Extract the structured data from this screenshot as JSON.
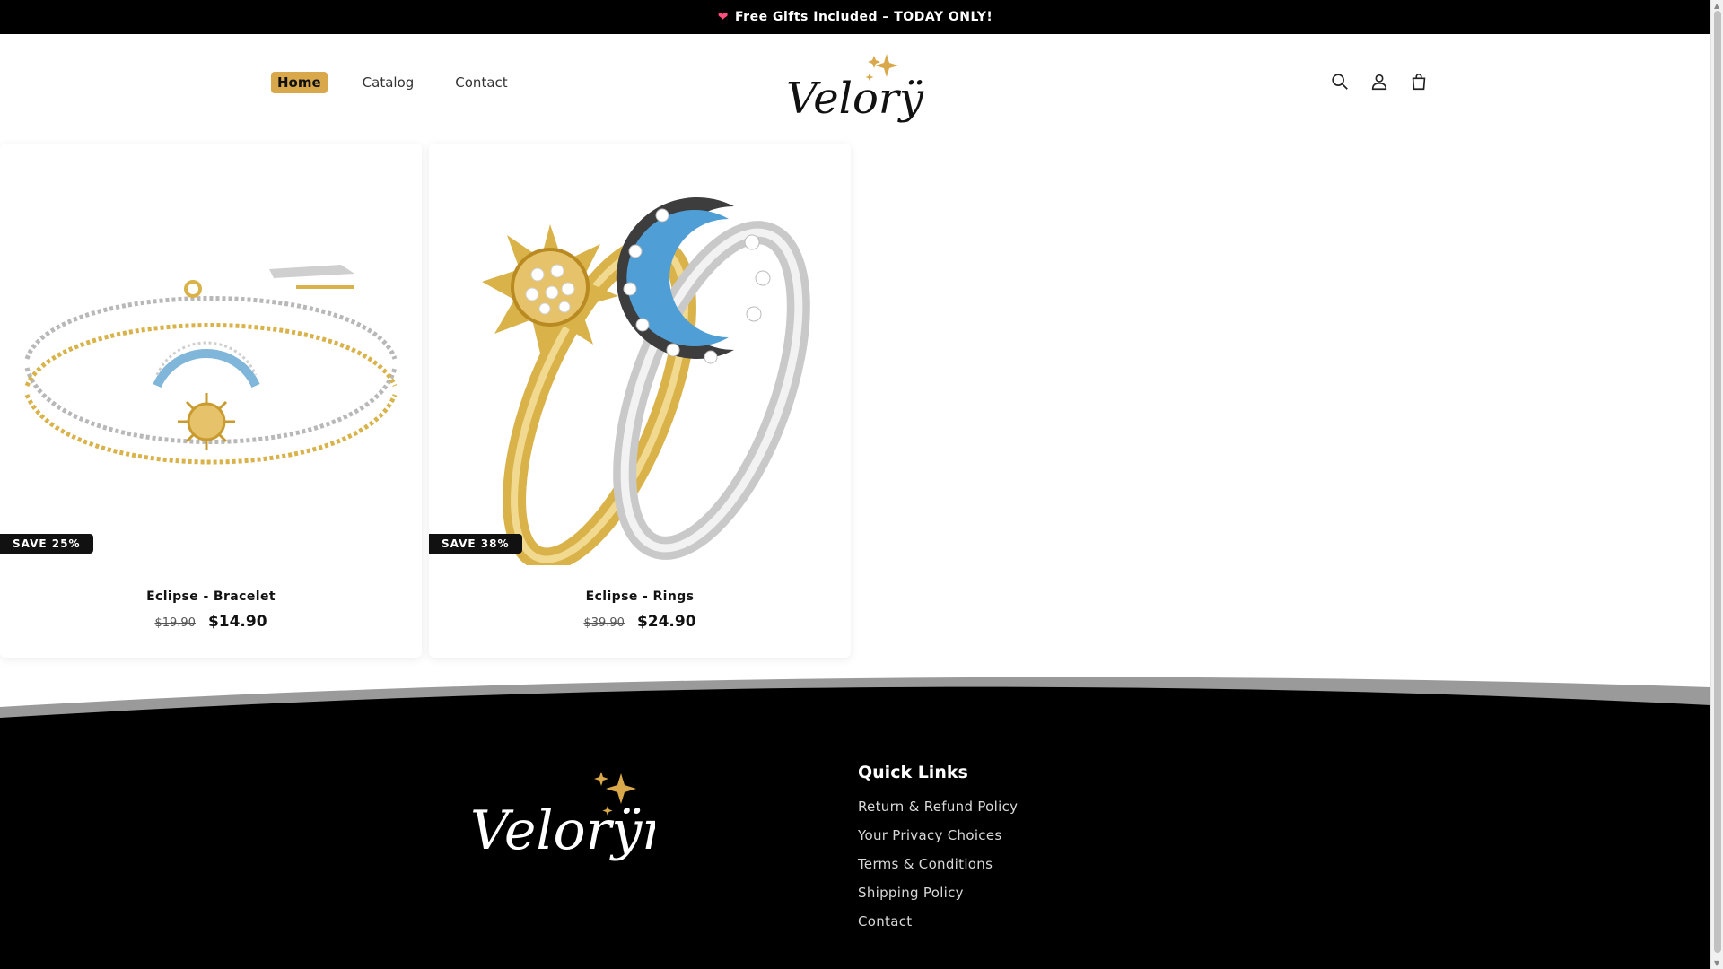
{
  "announcement": {
    "icon": "heart-icon",
    "text": "Free Gifts Included – TODAY ONLY!"
  },
  "nav": {
    "items": [
      {
        "label": "Home",
        "active": true
      },
      {
        "label": "Catalog",
        "active": false
      },
      {
        "label": "Contact",
        "active": false
      }
    ]
  },
  "brand": {
    "name": "Velorÿn",
    "accent_color": "#d9a84a"
  },
  "header_icons": [
    "search-icon",
    "account-icon",
    "cart-icon"
  ],
  "products": [
    {
      "title": "Eclipse - Bracelet",
      "badge": "SAVE 25%",
      "old_price": "$19.90",
      "new_price": "$14.90"
    },
    {
      "title": "Eclipse - Rings",
      "badge": "SAVE 38%",
      "old_price": "$39.90",
      "new_price": "$24.90"
    }
  ],
  "footer": {
    "heading": "Quick Links",
    "links": [
      "Return & Refund Policy",
      "Your Privacy Choices",
      "Terms & Conditions",
      "Shipping Policy",
      "Contact"
    ]
  }
}
